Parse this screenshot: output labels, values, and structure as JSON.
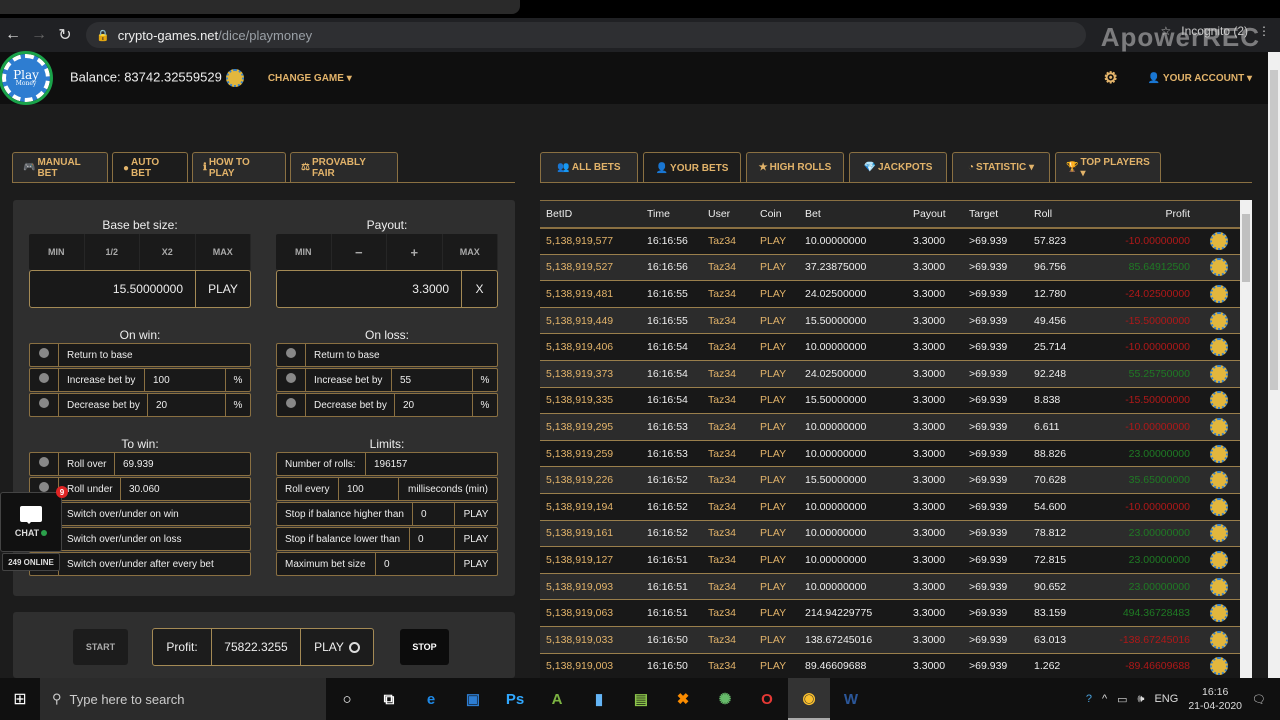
{
  "browser": {
    "url_host": "crypto-games.net",
    "url_path": "/dice/playmoney",
    "profile_label": "Incognito (2)",
    "watermark": "ApowerREC"
  },
  "header": {
    "logo_text": "Play",
    "logo_sub": "Money",
    "balance_label": "Balance: 83742.32559529",
    "change_game": "CHANGE GAME ▾",
    "account": "YOUR ACCOUNT ▾"
  },
  "left_tabs": [
    {
      "icon": "🎮",
      "label": "MANUAL BET",
      "active": false
    },
    {
      "icon": "●",
      "label": "AUTO BET",
      "active": true
    },
    {
      "icon": "ℹ",
      "label": "HOW TO PLAY",
      "active": false
    },
    {
      "icon": "⚖",
      "label": "PROVABLY FAIR",
      "active": false
    }
  ],
  "autobet": {
    "base_bet_title": "Base bet size:",
    "base_bet_buttons": [
      "MIN",
      "1/2",
      "X2",
      "MAX"
    ],
    "base_bet_value": "15.50000000",
    "base_bet_suffix": "PLAY",
    "payout_title": "Payout:",
    "payout_buttons": [
      "MIN",
      "−",
      "+",
      "MAX"
    ],
    "payout_value": "3.3000",
    "payout_suffix": "X",
    "on_win_title": "On win:",
    "on_win": {
      "return_label": "Return to base",
      "increase_label": "Increase bet by",
      "increase_value": "100",
      "decrease_label": "Decrease bet by",
      "decrease_value": "20",
      "unit": "%"
    },
    "on_loss_title": "On loss:",
    "on_loss": {
      "return_label": "Return to base",
      "increase_label": "Increase bet by",
      "increase_value": "55",
      "decrease_label": "Decrease bet by",
      "decrease_value": "20",
      "unit": "%"
    },
    "to_win_title": "To win:",
    "to_win": {
      "roll_over_label": "Roll over",
      "roll_over_value": "69.939",
      "roll_under_label": "Roll under",
      "roll_under_value": "30.060",
      "switch_win": "Switch over/under on win",
      "switch_loss": "Switch over/under on loss",
      "switch_every": "Switch over/under after every bet"
    },
    "limits_title": "Limits:",
    "limits": {
      "rolls_label": "Number of rolls:",
      "rolls_value": "196157",
      "roll_every_label": "Roll every",
      "roll_every_value": "100",
      "roll_every_unit": "milliseconds (min)",
      "stop_higher_label": "Stop if balance higher than",
      "stop_higher_value": "0",
      "stop_lower_label": "Stop if balance lower than",
      "stop_lower_value": "0",
      "max_bet_label": "Maximum bet size",
      "max_bet_value": "0",
      "coin": "PLAY"
    },
    "start_label": "START",
    "profit_label": "Profit:",
    "profit_value": "75822.3255",
    "profit_coin": "PLAY",
    "stop_label": "STOP"
  },
  "chat": {
    "label": "CHAT",
    "badge": "9",
    "online": "249 ONLINE"
  },
  "right_tabs": [
    {
      "icon": "👥",
      "label": "ALL BETS",
      "active": false
    },
    {
      "icon": "👤",
      "label": "YOUR BETS",
      "active": true
    },
    {
      "icon": "★",
      "label": "HIGH ROLLS",
      "active": false
    },
    {
      "icon": "💎",
      "label": "JACKPOTS",
      "active": false
    },
    {
      "icon": "◔",
      "label": "STATISTIC ▾",
      "active": false
    },
    {
      "icon": "🏆",
      "label": "TOP PLAYERS ▾",
      "active": false
    }
  ],
  "table": {
    "columns": [
      "BetID",
      "Time",
      "User",
      "Coin",
      "Bet",
      "Payout",
      "Target",
      "Roll",
      "Profit"
    ],
    "rows": [
      {
        "id": "5,138,919,577",
        "time": "16:16:56",
        "user": "Taz34",
        "coin": "PLAY",
        "bet": "10.00000000",
        "payout": "3.3000",
        "target": ">69.939",
        "roll": "57.823",
        "profit": "-10.00000000",
        "win": false
      },
      {
        "id": "5,138,919,527",
        "time": "16:16:56",
        "user": "Taz34",
        "coin": "PLAY",
        "bet": "37.23875000",
        "payout": "3.3000",
        "target": ">69.939",
        "roll": "96.756",
        "profit": "85.64912500",
        "win": true
      },
      {
        "id": "5,138,919,481",
        "time": "16:16:55",
        "user": "Taz34",
        "coin": "PLAY",
        "bet": "24.02500000",
        "payout": "3.3000",
        "target": ">69.939",
        "roll": "12.780",
        "profit": "-24.02500000",
        "win": false
      },
      {
        "id": "5,138,919,449",
        "time": "16:16:55",
        "user": "Taz34",
        "coin": "PLAY",
        "bet": "15.50000000",
        "payout": "3.3000",
        "target": ">69.939",
        "roll": "49.456",
        "profit": "-15.50000000",
        "win": false
      },
      {
        "id": "5,138,919,406",
        "time": "16:16:54",
        "user": "Taz34",
        "coin": "PLAY",
        "bet": "10.00000000",
        "payout": "3.3000",
        "target": ">69.939",
        "roll": "25.714",
        "profit": "-10.00000000",
        "win": false
      },
      {
        "id": "5,138,919,373",
        "time": "16:16:54",
        "user": "Taz34",
        "coin": "PLAY",
        "bet": "24.02500000",
        "payout": "3.3000",
        "target": ">69.939",
        "roll": "92.248",
        "profit": "55.25750000",
        "win": true
      },
      {
        "id": "5,138,919,335",
        "time": "16:16:54",
        "user": "Taz34",
        "coin": "PLAY",
        "bet": "15.50000000",
        "payout": "3.3000",
        "target": ">69.939",
        "roll": "8.838",
        "profit": "-15.50000000",
        "win": false
      },
      {
        "id": "5,138,919,295",
        "time": "16:16:53",
        "user": "Taz34",
        "coin": "PLAY",
        "bet": "10.00000000",
        "payout": "3.3000",
        "target": ">69.939",
        "roll": "6.611",
        "profit": "-10.00000000",
        "win": false
      },
      {
        "id": "5,138,919,259",
        "time": "16:16:53",
        "user": "Taz34",
        "coin": "PLAY",
        "bet": "10.00000000",
        "payout": "3.3000",
        "target": ">69.939",
        "roll": "88.826",
        "profit": "23.00000000",
        "win": true
      },
      {
        "id": "5,138,919,226",
        "time": "16:16:52",
        "user": "Taz34",
        "coin": "PLAY",
        "bet": "15.50000000",
        "payout": "3.3000",
        "target": ">69.939",
        "roll": "70.628",
        "profit": "35.65000000",
        "win": true
      },
      {
        "id": "5,138,919,194",
        "time": "16:16:52",
        "user": "Taz34",
        "coin": "PLAY",
        "bet": "10.00000000",
        "payout": "3.3000",
        "target": ">69.939",
        "roll": "54.600",
        "profit": "-10.00000000",
        "win": false
      },
      {
        "id": "5,138,919,161",
        "time": "16:16:52",
        "user": "Taz34",
        "coin": "PLAY",
        "bet": "10.00000000",
        "payout": "3.3000",
        "target": ">69.939",
        "roll": "78.812",
        "profit": "23.00000000",
        "win": true
      },
      {
        "id": "5,138,919,127",
        "time": "16:16:51",
        "user": "Taz34",
        "coin": "PLAY",
        "bet": "10.00000000",
        "payout": "3.3000",
        "target": ">69.939",
        "roll": "72.815",
        "profit": "23.00000000",
        "win": true
      },
      {
        "id": "5,138,919,093",
        "time": "16:16:51",
        "user": "Taz34",
        "coin": "PLAY",
        "bet": "10.00000000",
        "payout": "3.3000",
        "target": ">69.939",
        "roll": "90.652",
        "profit": "23.00000000",
        "win": true
      },
      {
        "id": "5,138,919,063",
        "time": "16:16:51",
        "user": "Taz34",
        "coin": "PLAY",
        "bet": "214.94229775",
        "payout": "3.3000",
        "target": ">69.939",
        "roll": "83.159",
        "profit": "494.36728483",
        "win": true
      },
      {
        "id": "5,138,919,033",
        "time": "16:16:50",
        "user": "Taz34",
        "coin": "PLAY",
        "bet": "138.67245016",
        "payout": "3.3000",
        "target": ">69.939",
        "roll": "63.013",
        "profit": "-138.67245016",
        "win": false
      },
      {
        "id": "5,138,919,003",
        "time": "16:16:50",
        "user": "Taz34",
        "coin": "PLAY",
        "bet": "89.46609688",
        "payout": "3.3000",
        "target": ">69.939",
        "roll": "1.262",
        "profit": "-89.46609688",
        "win": false
      }
    ]
  },
  "taskbar": {
    "search_placeholder": "Type here to search",
    "lang": "ENG",
    "time": "16:16",
    "date": "21-04-2020"
  },
  "colors": {
    "accent_gold": "#e2b36a",
    "loss_red": "#b01818",
    "win_green": "#1f7a24"
  }
}
